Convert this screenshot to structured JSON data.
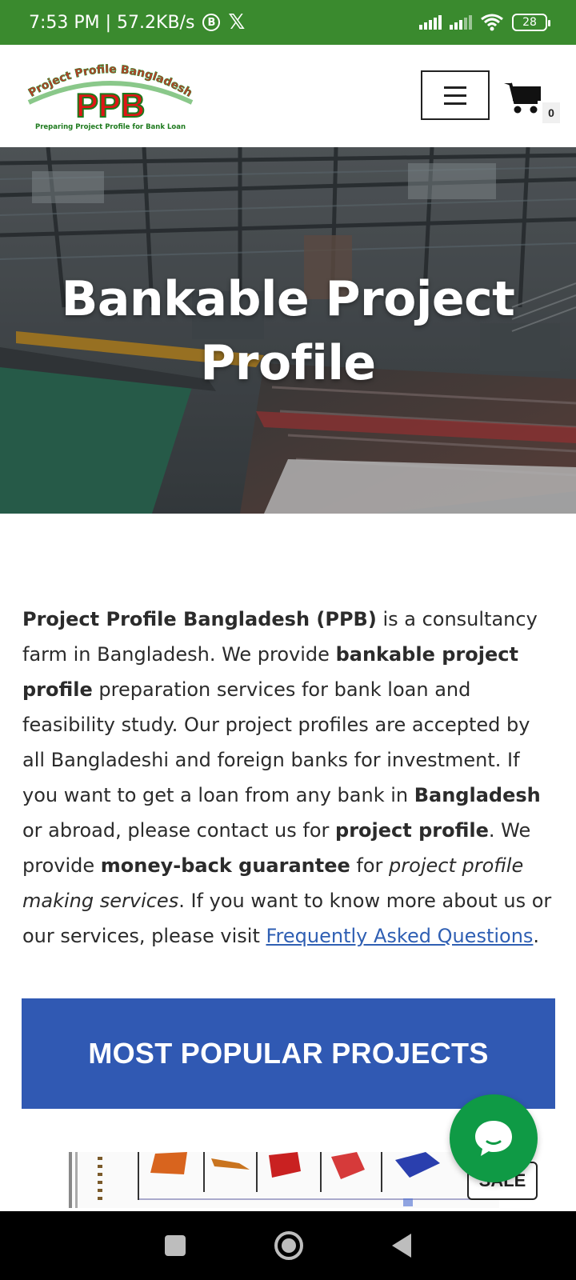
{
  "status_bar": {
    "time": "7:53 PM | 57.2KB/s",
    "b_badge": "B",
    "x_icon": "𝕏",
    "battery": "28"
  },
  "header": {
    "logo_arc_text": "Project Profile Bangladesh",
    "logo_main": "PPB",
    "logo_tagline": "Preparing Project Profile for Bank Loan",
    "cart_count": "0"
  },
  "hero": {
    "title_line1": "Bankable Project",
    "title_line2": "Profile"
  },
  "intro": {
    "p1_bold": "Project Profile Bangladesh (PPB)",
    "p2": " is a consultancy farm in Bangladesh. We provide ",
    "p3_bold": "bankable project profile",
    "p4": " preparation services for bank loan and feasibility study. Our project profiles are accepted by all Bangladeshi and foreign banks for investment. If you want to get a loan from any bank in ",
    "p5_bold": "Bangladesh",
    "p6": " or abroad, please contact us for ",
    "p7_bold": "project profile",
    "p8": ". We provide ",
    "p9_bold": "money-back guarantee",
    "p10": " for ",
    "p11_italic": "project profile making services",
    "p12": ". If you want to know more about us or our services, please visit ",
    "link_text": "Frequently Asked Questions",
    "p13": "."
  },
  "popular": {
    "title": "MOST POPULAR PROJECTS"
  },
  "product": {
    "sale_badge": "SALE"
  },
  "colors": {
    "status_bar": "#3a8a2e",
    "banner": "#3059b3",
    "chat": "#0f9a45",
    "link": "#2f5fb3"
  },
  "icons": {
    "menu": "hamburger-icon",
    "cart": "shopping-cart-icon",
    "chat": "chat-bubble-icon"
  }
}
